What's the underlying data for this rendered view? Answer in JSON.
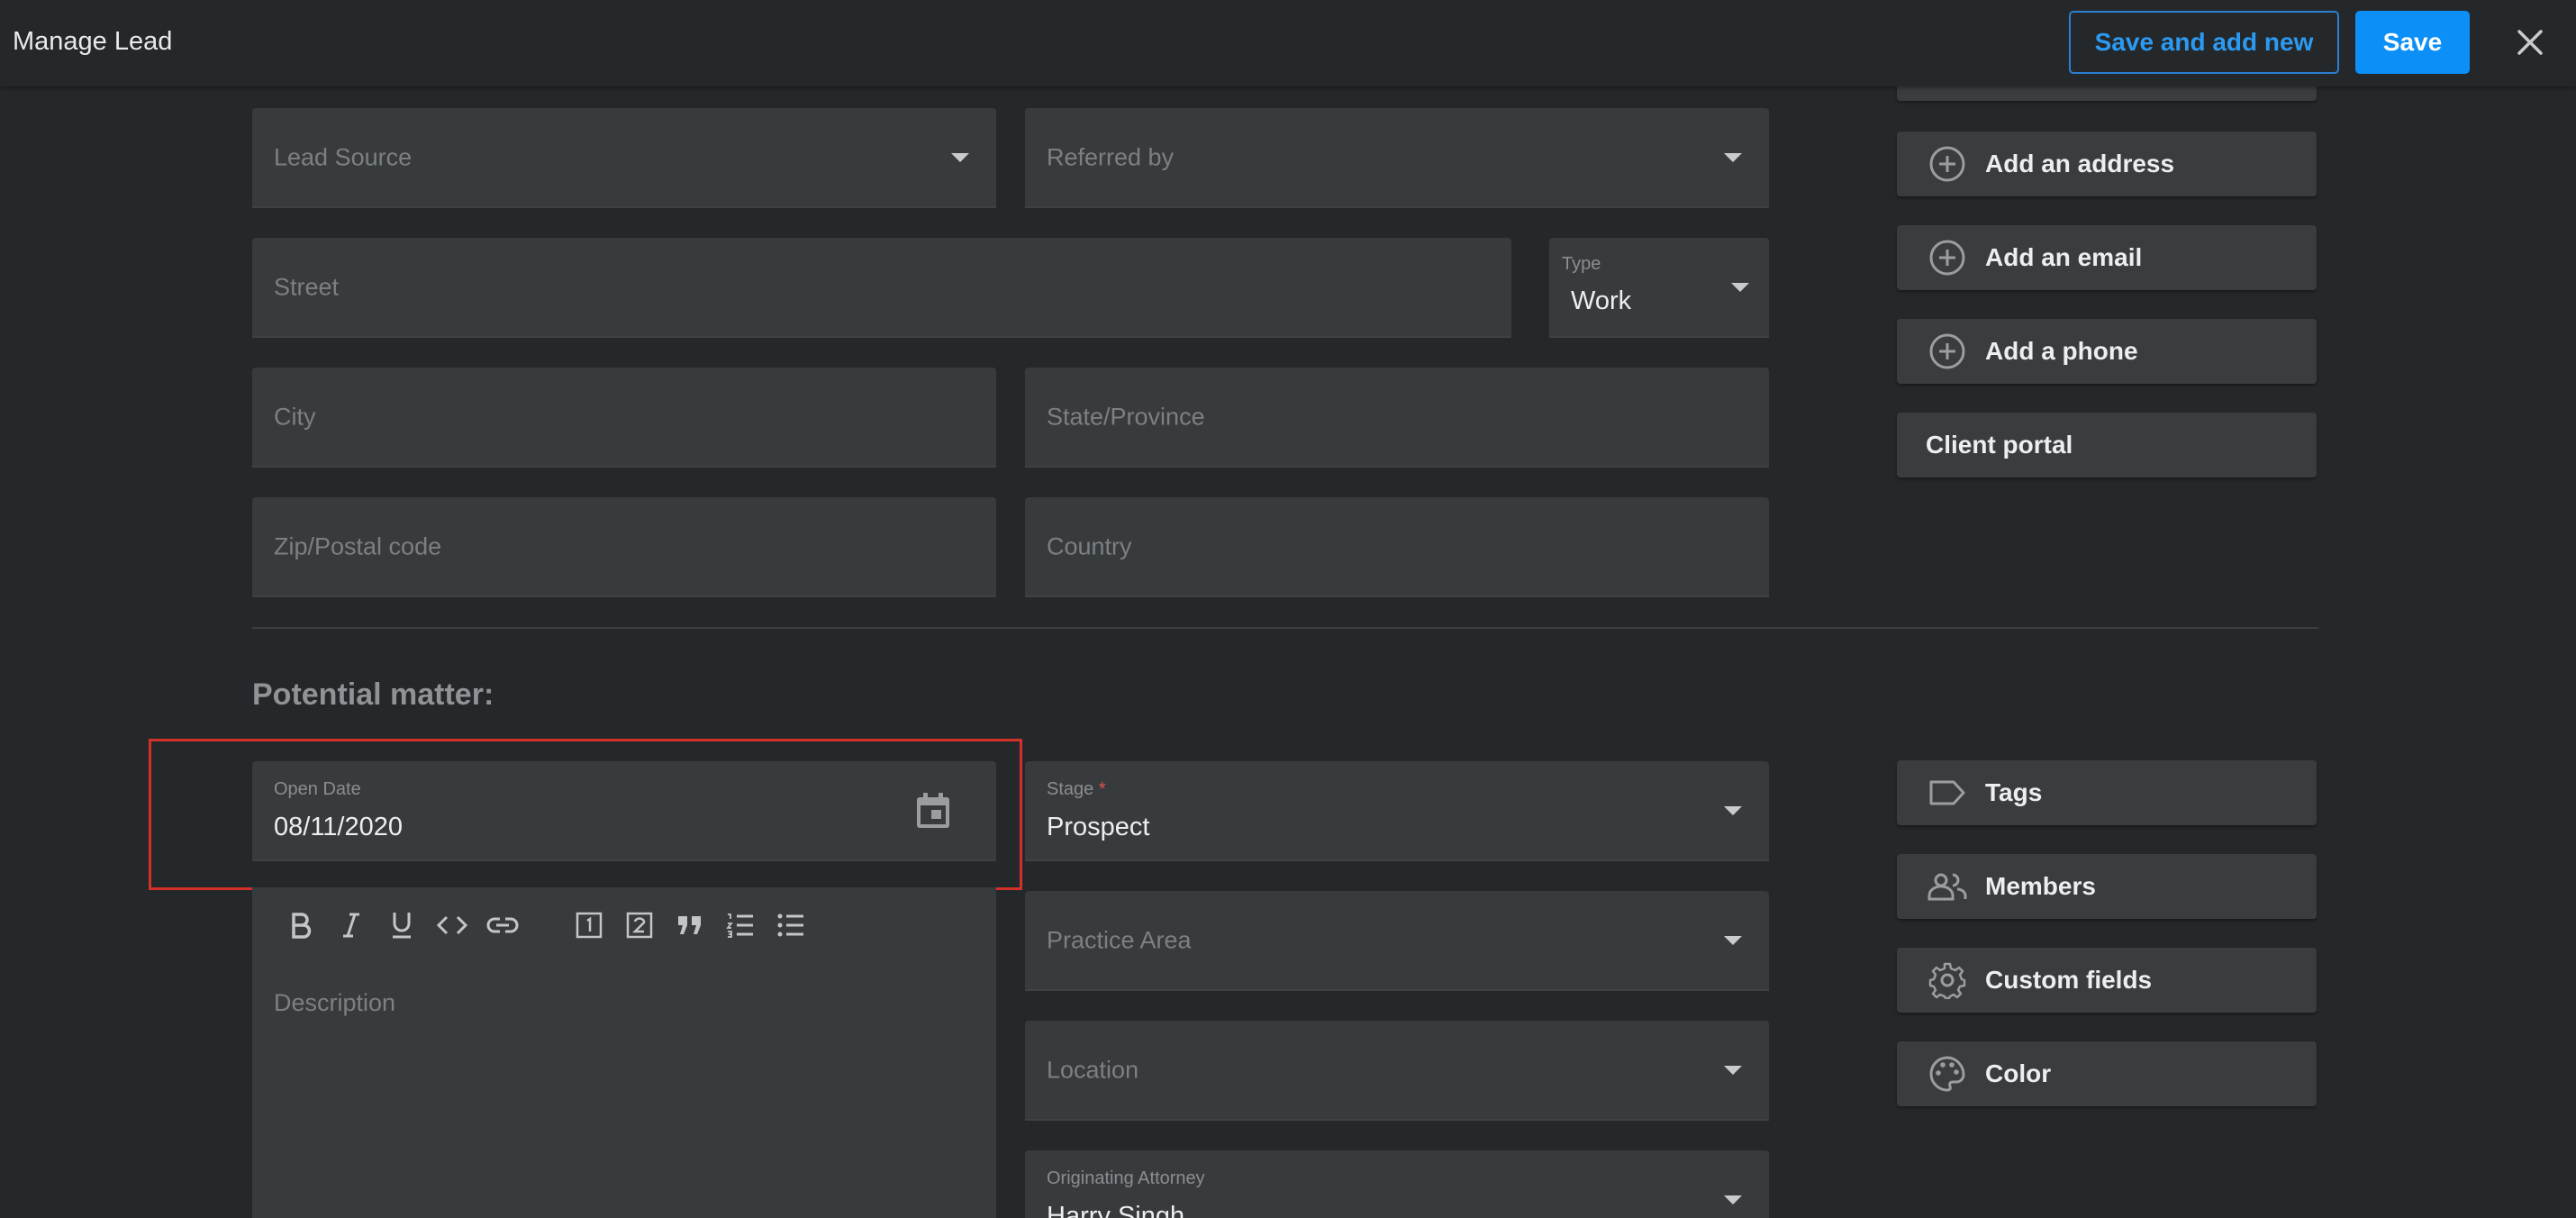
{
  "header": {
    "title": "Manage Lead",
    "save_and_add_new": "Save and add new",
    "save": "Save"
  },
  "contact_fields": {
    "lead_source": "Lead Source",
    "referred_by": "Referred by",
    "street": "Street",
    "type_label": "Type",
    "type_value": "Work",
    "city": "City",
    "state": "State/Province",
    "zip": "Zip/Postal code",
    "country": "Country"
  },
  "side_actions": {
    "add_address": "Add an address",
    "add_email": "Add an email",
    "add_phone": "Add a phone",
    "client_portal": "Client portal"
  },
  "matter": {
    "section_title": "Potential matter:",
    "open_date_label": "Open Date",
    "open_date_value": "08/11/2020",
    "stage_label": "Stage",
    "stage_required": "*",
    "stage_value": "Prospect",
    "practice_area": "Practice Area",
    "location": "Location",
    "originating_attorney_label": "Originating Attorney",
    "originating_attorney_value": "Harry Singh",
    "description": "Description"
  },
  "matter_actions": {
    "tags": "Tags",
    "members": "Members",
    "custom_fields": "Custom fields",
    "color": "Color"
  },
  "editor_toolbar": [
    "bold-icon",
    "italic-icon",
    "underline-icon",
    "code-icon",
    "link-icon",
    "heading1-icon",
    "heading2-icon",
    "quote-icon",
    "ordered-list-icon",
    "bullet-list-icon"
  ],
  "colors": {
    "background": "#25282a",
    "field": "#383b3d",
    "accent": "#0c8ff7",
    "highlight": "#d4302a"
  }
}
